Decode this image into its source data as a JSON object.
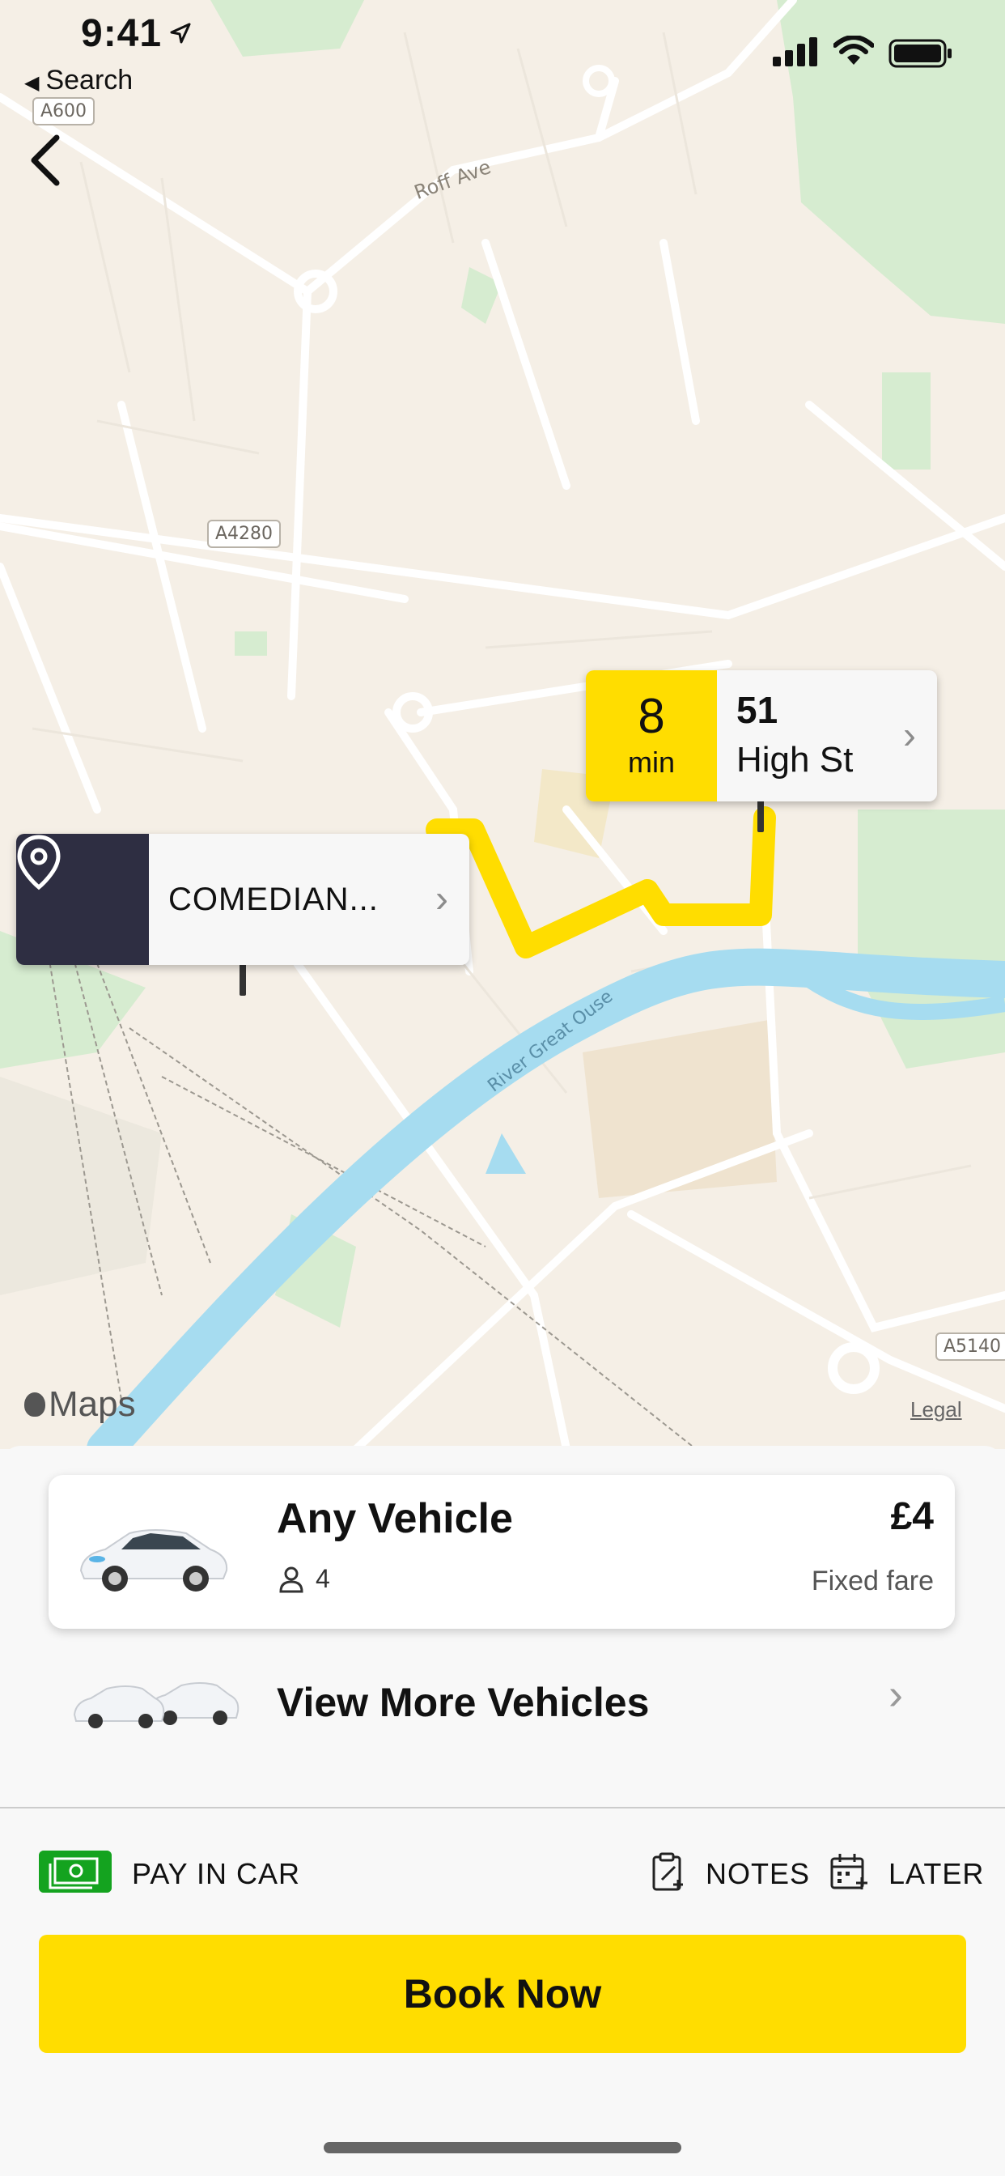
{
  "status_bar": {
    "time": "9:41",
    "back_app": "Search"
  },
  "map": {
    "road_labels": {
      "roff_ave": "Roff Ave",
      "river": "River Great Ouse"
    },
    "shields": {
      "a600": "A600",
      "a4280": "A4280",
      "a5140": "A5140"
    },
    "attribution": "Maps",
    "legal": "Legal",
    "route_color": "#ffdd00",
    "water_color": "#a6dcf0"
  },
  "destination": {
    "eta_value": "8",
    "eta_unit": "min",
    "number": "51",
    "street": "High St"
  },
  "pickup": {
    "label": "COMEDIAN..."
  },
  "vehicle": {
    "name": "Any Vehicle",
    "seats": "4",
    "price": "£4",
    "fare_type": "Fixed fare"
  },
  "more_vehicles": {
    "label": "View More Vehicles"
  },
  "options": {
    "payment": "PAY IN CAR",
    "notes": "NOTES",
    "later": "LATER"
  },
  "book_button": "Book Now",
  "colors": {
    "accent": "#ffdd00",
    "dark": "#2e2e42",
    "pay_green": "#14a31f"
  }
}
